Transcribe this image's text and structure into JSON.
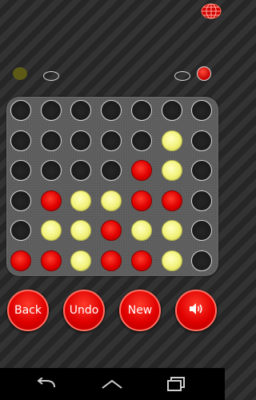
{
  "indicators": {
    "left_player_color": "#5c5a16",
    "right_player_color": "#e00000"
  },
  "board": {
    "rows": 6,
    "cols": 7,
    "grid": [
      [
        "empty",
        "empty",
        "empty",
        "empty",
        "empty",
        "empty",
        "empty"
      ],
      [
        "empty",
        "empty",
        "empty",
        "empty",
        "empty",
        "yellow",
        "empty"
      ],
      [
        "empty",
        "empty",
        "empty",
        "empty",
        "red",
        "yellow",
        "empty"
      ],
      [
        "empty",
        "red",
        "yellow",
        "yellow",
        "red",
        "red",
        "empty"
      ],
      [
        "empty",
        "yellow",
        "yellow",
        "red",
        "yellow",
        "yellow",
        "empty"
      ],
      [
        "red",
        "red",
        "yellow",
        "red",
        "red",
        "yellow",
        "empty"
      ]
    ]
  },
  "buttons": {
    "back_label": "Back",
    "undo_label": "Undo",
    "new_label": "New",
    "sound_icon": "speaker-icon"
  },
  "colors": {
    "red_piece": "#e00000",
    "yellow_piece": "#f2f27a",
    "board": "#5b5b5b"
  }
}
